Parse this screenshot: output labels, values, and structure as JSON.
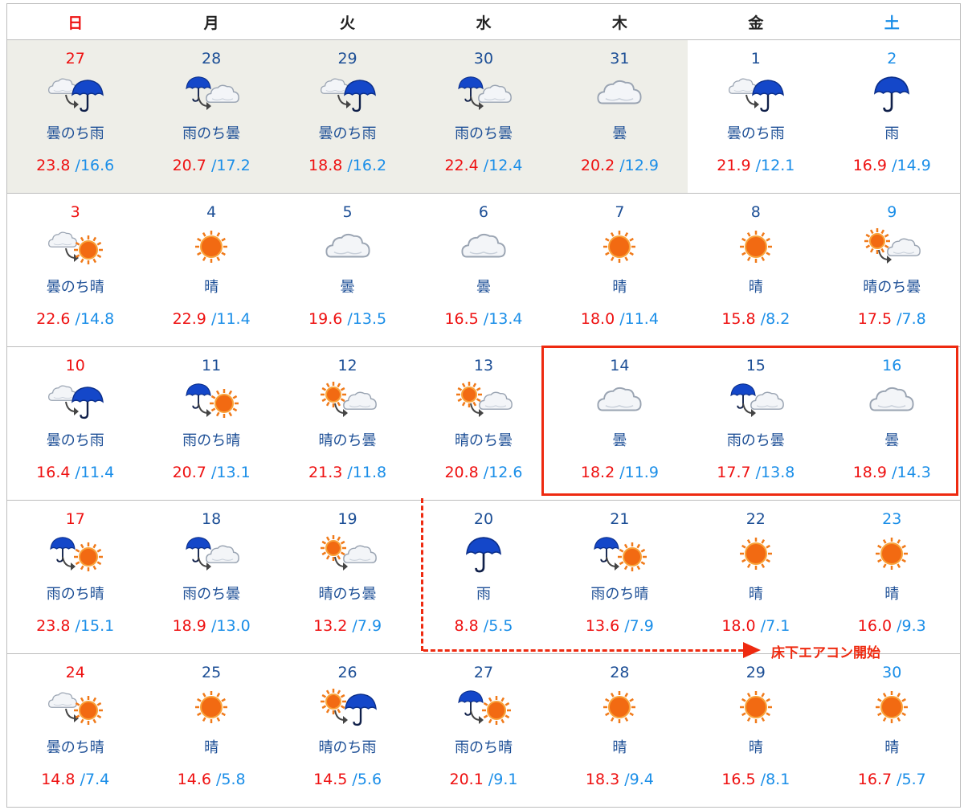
{
  "weekdays": [
    {
      "label": "日",
      "kind": "sun"
    },
    {
      "label": "月",
      "kind": "weekday"
    },
    {
      "label": "火",
      "kind": "weekday"
    },
    {
      "label": "水",
      "kind": "weekday"
    },
    {
      "label": "木",
      "kind": "weekday"
    },
    {
      "label": "金",
      "kind": "weekday"
    },
    {
      "label": "土",
      "kind": "sat"
    }
  ],
  "weeks": [
    [
      {
        "day": "27",
        "weather": "曇のち雨",
        "icon": "cloud-then-rain-icon",
        "high": "23.8",
        "low": "16.6",
        "past": true
      },
      {
        "day": "28",
        "weather": "雨のち曇",
        "icon": "rain-then-cloud-icon",
        "high": "20.7",
        "low": "17.2",
        "past": true
      },
      {
        "day": "29",
        "weather": "曇のち雨",
        "icon": "cloud-then-rain-icon",
        "high": "18.8",
        "low": "16.2",
        "past": true
      },
      {
        "day": "30",
        "weather": "雨のち曇",
        "icon": "rain-then-cloud-icon",
        "high": "22.4",
        "low": "12.4",
        "past": true
      },
      {
        "day": "31",
        "weather": "曇",
        "icon": "cloud-icon",
        "high": "20.2",
        "low": "12.9",
        "past": true
      },
      {
        "day": "1",
        "weather": "曇のち雨",
        "icon": "cloud-then-rain-icon",
        "high": "21.9",
        "low": "12.1",
        "past": false
      },
      {
        "day": "2",
        "weather": "雨",
        "icon": "rain-icon",
        "high": "16.9",
        "low": "14.9",
        "past": false
      }
    ],
    [
      {
        "day": "3",
        "weather": "曇のち晴",
        "icon": "cloud-then-sun-icon",
        "high": "22.6",
        "low": "14.8"
      },
      {
        "day": "4",
        "weather": "晴",
        "icon": "sun-icon",
        "high": "22.9",
        "low": "11.4"
      },
      {
        "day": "5",
        "weather": "曇",
        "icon": "cloud-icon",
        "high": "19.6",
        "low": "13.5"
      },
      {
        "day": "6",
        "weather": "曇",
        "icon": "cloud-icon",
        "high": "16.5",
        "low": "13.4"
      },
      {
        "day": "7",
        "weather": "晴",
        "icon": "sun-icon",
        "high": "18.0",
        "low": "11.4"
      },
      {
        "day": "8",
        "weather": "晴",
        "icon": "sun-icon",
        "high": "15.8",
        "low": "8.2"
      },
      {
        "day": "9",
        "weather": "晴のち曇",
        "icon": "sun-then-cloud-icon",
        "high": "17.5",
        "low": "7.8"
      }
    ],
    [
      {
        "day": "10",
        "weather": "曇のち雨",
        "icon": "cloud-then-rain-icon",
        "high": "16.4",
        "low": "11.4"
      },
      {
        "day": "11",
        "weather": "雨のち晴",
        "icon": "rain-then-sun-icon",
        "high": "20.7",
        "low": "13.1"
      },
      {
        "day": "12",
        "weather": "晴のち曇",
        "icon": "sun-then-cloud-icon",
        "high": "21.3",
        "low": "11.8"
      },
      {
        "day": "13",
        "weather": "晴のち曇",
        "icon": "sun-then-cloud-icon",
        "high": "20.8",
        "low": "12.6"
      },
      {
        "day": "14",
        "weather": "曇",
        "icon": "cloud-icon",
        "high": "18.2",
        "low": "11.9"
      },
      {
        "day": "15",
        "weather": "雨のち曇",
        "icon": "rain-then-cloud-icon",
        "high": "17.7",
        "low": "13.8"
      },
      {
        "day": "16",
        "weather": "曇",
        "icon": "cloud-icon",
        "high": "18.9",
        "low": "14.3"
      }
    ],
    [
      {
        "day": "17",
        "weather": "雨のち晴",
        "icon": "rain-then-sun-icon",
        "high": "23.8",
        "low": "15.1"
      },
      {
        "day": "18",
        "weather": "雨のち曇",
        "icon": "rain-then-cloud-icon",
        "high": "18.9",
        "low": "13.0"
      },
      {
        "day": "19",
        "weather": "晴のち曇",
        "icon": "sun-then-cloud-icon",
        "high": "13.2",
        "low": "7.9"
      },
      {
        "day": "20",
        "weather": "雨",
        "icon": "rain-icon",
        "high": "8.8",
        "low": "5.5"
      },
      {
        "day": "21",
        "weather": "雨のち晴",
        "icon": "rain-then-sun-icon",
        "high": "13.6",
        "low": "7.9"
      },
      {
        "day": "22",
        "weather": "晴",
        "icon": "sun-icon",
        "high": "18.0",
        "low": "7.1"
      },
      {
        "day": "23",
        "weather": "晴",
        "icon": "sun-icon",
        "high": "16.0",
        "low": "9.3"
      }
    ],
    [
      {
        "day": "24",
        "weather": "曇のち晴",
        "icon": "cloud-then-sun-icon",
        "high": "14.8",
        "low": "7.4"
      },
      {
        "day": "25",
        "weather": "晴",
        "icon": "sun-icon",
        "high": "14.6",
        "low": "5.8"
      },
      {
        "day": "26",
        "weather": "晴のち雨",
        "icon": "sun-then-rain-icon",
        "high": "14.5",
        "low": "5.6"
      },
      {
        "day": "27",
        "weather": "雨のち晴",
        "icon": "rain-then-sun-icon",
        "high": "20.1",
        "low": "9.1"
      },
      {
        "day": "28",
        "weather": "晴",
        "icon": "sun-icon",
        "high": "18.3",
        "low": "9.4"
      },
      {
        "day": "29",
        "weather": "晴",
        "icon": "sun-icon",
        "high": "16.5",
        "low": "8.1"
      },
      {
        "day": "30",
        "weather": "晴",
        "icon": "sun-icon",
        "high": "16.7",
        "low": "5.7"
      }
    ]
  ],
  "annotation": {
    "label": "床下エアコン開始",
    "color": "#ee2a10"
  },
  "colors": {
    "sunday_red": "#ee1111",
    "saturday_blue": "#1a8ee8",
    "weekday_navy": "#1d4f96",
    "past_bg": "#eeeee8"
  }
}
